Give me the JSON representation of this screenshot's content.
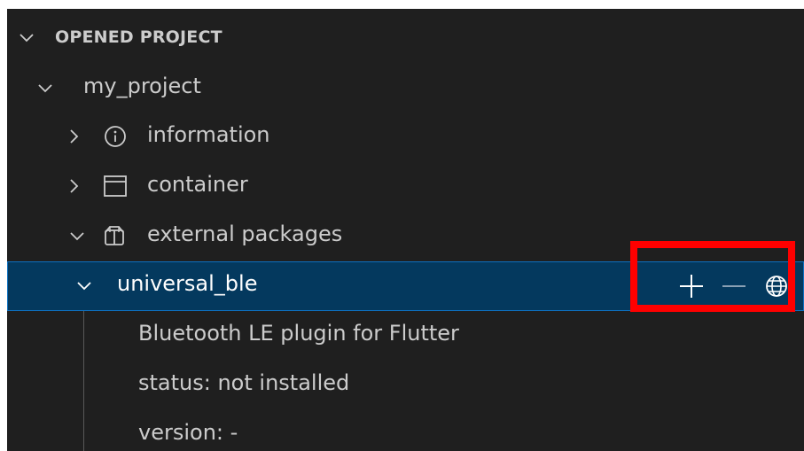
{
  "section": {
    "title": "OPENED PROJECT"
  },
  "tree": {
    "project": {
      "label": "my_project"
    },
    "information": {
      "label": "information",
      "icon": "info-icon"
    },
    "container": {
      "label": "container",
      "icon": "window-icon"
    },
    "external_packages": {
      "label": "external packages",
      "icon": "package-icon"
    },
    "package": {
      "label": "universal_ble",
      "actions": {
        "add": "add-icon",
        "remove": "remove-icon",
        "web": "globe-icon"
      },
      "description": "Bluetooth LE plugin for Flutter",
      "status": "status: not installed",
      "version": "version: -"
    }
  },
  "colors": {
    "panel_background": "#1f1f1f",
    "selection_background": "#04395e",
    "selection_border": "#0e70c0",
    "highlight_box": "#ff0000"
  }
}
